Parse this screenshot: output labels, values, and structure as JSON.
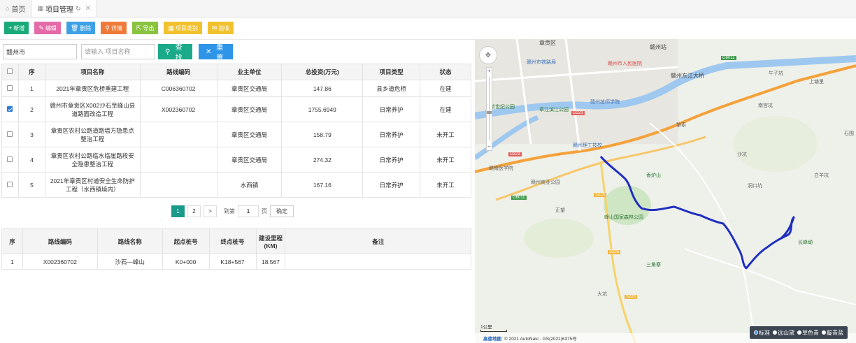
{
  "tabs": [
    {
      "label": "首页",
      "icon": "home-icon"
    },
    {
      "label": "项目管理",
      "icon": "grid-icon",
      "active": true
    }
  ],
  "toolbar": {
    "add": "新增",
    "edit": "编辑",
    "delete": "删除",
    "detail": "详情",
    "export": "导出",
    "project_type": "项目类别",
    "accept": "验收"
  },
  "search": {
    "region_value": "赣州市",
    "name_placeholder": "请输入 项目名称",
    "find": "查找",
    "reset": "重置"
  },
  "projects": {
    "headers": [
      "序",
      "项目名称",
      "路线编码",
      "业主单位",
      "总投资(万元)",
      "项目类型",
      "状态"
    ],
    "rows": [
      {
        "no": "1",
        "name": "2021年章贡区危桥重建工程",
        "code": "C006360702",
        "owner": "章贡区交通局",
        "investment": "147.86",
        "type": "县乡道危桥",
        "status": "在建",
        "checked": false
      },
      {
        "no": "2",
        "name": "赣州市章贡区X002沙石至峰山县道路面改造工程",
        "code": "X002360702",
        "owner": "章贡区交通局",
        "investment": "1755.6949",
        "type": "日常养护",
        "status": "在建",
        "checked": true
      },
      {
        "no": "3",
        "name": "章贡区农村公路道路墙方隐患点整治工程",
        "code": "",
        "owner": "章贡区交通局",
        "investment": "158.79",
        "type": "日常养护",
        "status": "未开工",
        "checked": false
      },
      {
        "no": "4",
        "name": "章贡区农村公路临水临崖路段安全隐患整治工程",
        "code": "",
        "owner": "章贡区交通局",
        "investment": "274.32",
        "type": "日常养护",
        "status": "未开工",
        "checked": false
      },
      {
        "no": "5",
        "name": "2021年章贡区村道安全生命防护工程（水西镇境内）",
        "code": "",
        "owner": "水西镇",
        "investment": "167.16",
        "type": "日常养护",
        "status": "未开工",
        "checked": false
      }
    ]
  },
  "pagination": {
    "pages": [
      "1",
      "2"
    ],
    "next": ">",
    "goto_prefix": "到第",
    "goto_value": "1",
    "goto_suffix": "页",
    "confirm": "确定"
  },
  "routes": {
    "headers": [
      "序",
      "路线编码",
      "路线名称",
      "起点桩号",
      "终点桩号",
      "建设里程(KM)",
      "备注"
    ],
    "rows": [
      {
        "no": "1",
        "code": "X002360702",
        "name": "沙石—峰山",
        "start": "K0+000",
        "end": "K18+567",
        "length": "18.567",
        "note": ""
      }
    ]
  },
  "map": {
    "labels": {
      "zhanggong": "章贡区",
      "ganzhou_station": "赣州站",
      "ganzhou_railway": "赣州市铁路局",
      "people_hosp": "赣州市人民医院",
      "dongjiang_bridge": "赣州东江大桥",
      "tech_college": "赣州技师学院",
      "new_century": "新世纪公园",
      "park_river": "章江滨江公园",
      "sci_school": "赣州理工技校",
      "gannan_med": "赣南医学院",
      "gannan_park": "赣州南亚公园",
      "xianglu": "香炉山",
      "fengshan_forest": "峰山国家森林公园",
      "sanjiaoyuan": "三角寨",
      "changfeng": "长峰坳",
      "shajiao": "沙坑",
      "zhengwang": "正望",
      "niuzi": "牛子坑",
      "shangtang": "上塘里",
      "shiwei": "石围",
      "lisu": "黎索",
      "nangong": "南宫坑",
      "baiyang": "白羊坑",
      "dongkeng": "洞口坑",
      "tiger": "大坑"
    },
    "roads": [
      "G323",
      "G323",
      "G6011",
      "G6011",
      "S226",
      "S226",
      "S226"
    ],
    "scale": "1公里",
    "copyright": "© 2021 AutoNavi - GS(2021)6375号",
    "provider": "高德地图",
    "layers": [
      "标准",
      "远山黛",
      "草色青",
      "靛青蓝"
    ]
  }
}
